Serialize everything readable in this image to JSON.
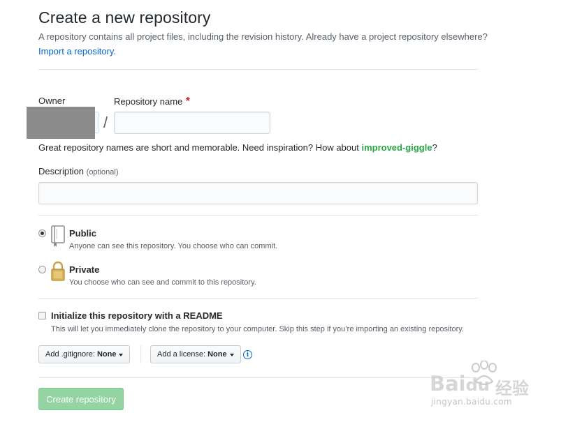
{
  "header": {
    "title": "Create a new repository",
    "subtitle": "A repository contains all project files, including the revision history. Already have a project repository elsewhere?",
    "import_link": "Import a repository."
  },
  "form": {
    "owner_label": "Owner",
    "repo_label": "Repository name",
    "required_mark": "*",
    "slash": "/",
    "repo_value": "",
    "hint_prefix": "Great repository names are short and memorable. Need inspiration? How about ",
    "hint_suggestion": "improved-giggle",
    "hint_suffix": "?",
    "description_label": "Description",
    "description_optional": "(optional)",
    "description_value": ""
  },
  "visibility": {
    "selected": "public",
    "public": {
      "title": "Public",
      "desc": "Anyone can see this repository. You choose who can commit.",
      "icon": "repo-book-icon"
    },
    "private": {
      "title": "Private",
      "desc": "You choose who can see and commit to this repository.",
      "icon": "lock-icon"
    }
  },
  "init": {
    "checked": false,
    "title": "Initialize this repository with a README",
    "desc": "This will let you immediately clone the repository to your computer. Skip this step if you’re importing an existing repository."
  },
  "options": {
    "gitignore_label": "Add .gitignore:",
    "gitignore_value": "None",
    "license_label": "Add a license:",
    "license_value": "None",
    "info_icon": "i"
  },
  "submit": {
    "label": "Create repository"
  },
  "watermark": {
    "brand": "Bai",
    "brand2": "du",
    "cn": "经验",
    "url": "jingyan.baidu.com"
  },
  "colors": {
    "link": "#0366d6",
    "suggestion": "#28a745",
    "required": "#cb2431",
    "create_button": "#94d3a2"
  }
}
